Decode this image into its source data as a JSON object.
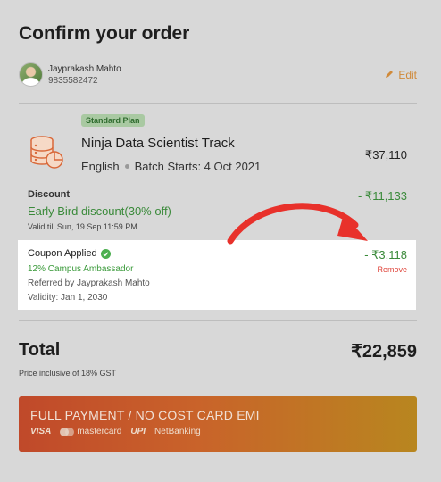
{
  "page": {
    "title": "Confirm your order"
  },
  "user": {
    "name": "Jayprakash Mahto",
    "phone": "9835582472",
    "edit_label": "Edit"
  },
  "course": {
    "badge": "Standard Plan",
    "title": "Ninja Data Scientist Track",
    "language": "English",
    "batch": "Batch Starts: 4 Oct 2021",
    "price": "₹37,110"
  },
  "discount": {
    "label": "Discount",
    "description": "Early Bird discount(30% off)",
    "valid_till": "Valid till Sun, 19 Sep 11:59 PM",
    "amount": "- ₹11,133"
  },
  "coupon": {
    "title": "Coupon Applied",
    "name": "12% Campus Ambassador",
    "referred_by": "Referred by Jayprakash Mahto",
    "validity": "Validity: Jan 1, 2030",
    "amount": "- ₹3,118",
    "remove_label": "Remove"
  },
  "total": {
    "label": "Total",
    "amount": "₹22,859",
    "note": "Price inclusive of 18% GST"
  },
  "payment": {
    "button_label": "FULL PAYMENT / NO COST CARD EMI",
    "methods": {
      "visa": "VISA",
      "mastercard": "mastercard",
      "upi": "UPI",
      "netbanking": "NetBanking"
    }
  },
  "colors": {
    "accent": "#d08a3a",
    "success": "#3a8a3a",
    "danger": "#e0463c",
    "annotation_arrow": "#e8312b"
  }
}
